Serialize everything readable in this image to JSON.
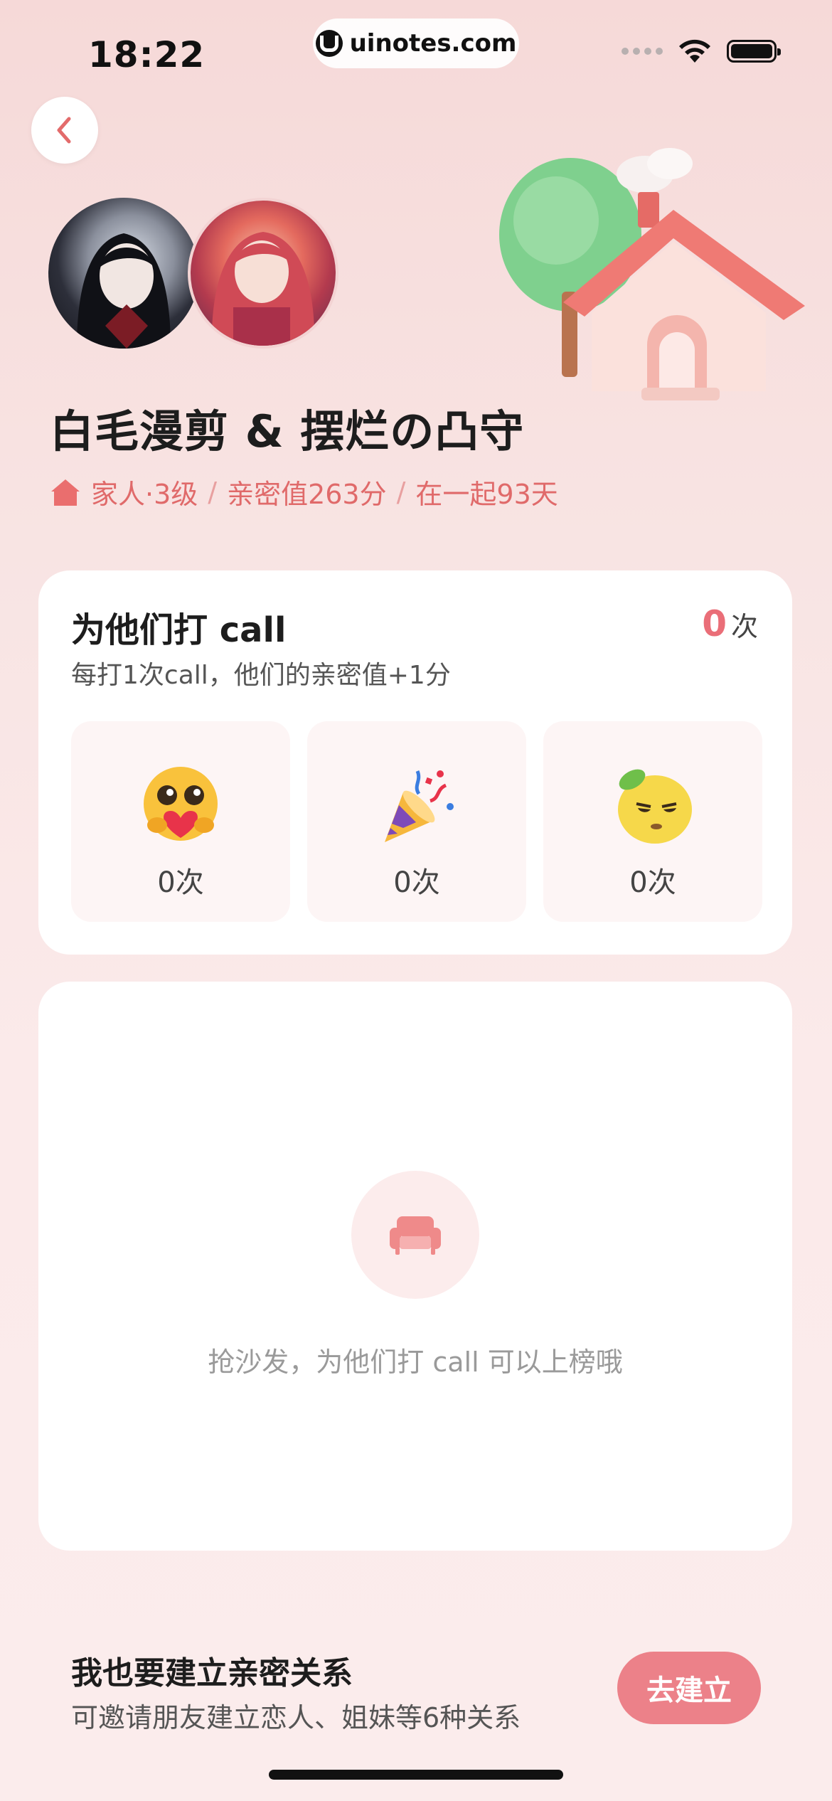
{
  "status_bar": {
    "time": "18:22",
    "url": "uinotes.com"
  },
  "header": {
    "pair_title": "白毛漫剪 & 摆烂の凸守",
    "relation": {
      "type": "家人·3级",
      "intimacy": "亲密值263分",
      "days": "在一起93天",
      "separator": "/"
    }
  },
  "call_card": {
    "title": "为他们打 call",
    "count_value": "0",
    "count_unit": "次",
    "subtitle": "每打1次call，他们的亲密值+1分",
    "reactions": [
      {
        "icon": "hug-heart-emoji",
        "count": "0次"
      },
      {
        "icon": "party-popper-emoji",
        "count": "0次"
      },
      {
        "icon": "lemon-face-emoji",
        "count": "0次"
      }
    ]
  },
  "leaderboard": {
    "empty_text": "抢沙发，为他们打 call 可以上榜哦",
    "icon": "sofa-icon"
  },
  "cta": {
    "title": "我也要建立亲密关系",
    "subtitle": "可邀请朋友建立恋人、姐妹等6种关系",
    "button_label": "去建立"
  },
  "colors": {
    "accent": "#ea6e78",
    "button": "#ec8189",
    "relation_text": "#e06a6a"
  }
}
